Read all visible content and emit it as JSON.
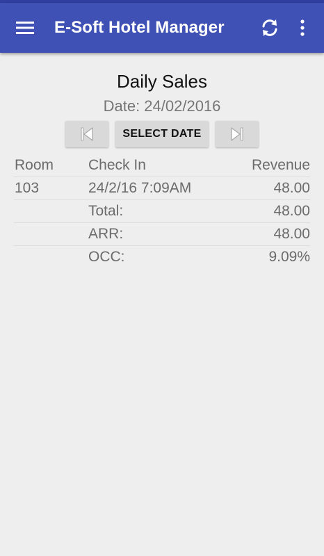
{
  "app_bar": {
    "title": "E-Soft Hotel Manager"
  },
  "report": {
    "title": "Daily Sales",
    "date": "Date: 24/02/2016",
    "select_date_label": "SELECT DATE"
  },
  "table": {
    "headers": {
      "room": "Room",
      "check_in": "Check In",
      "revenue": "Revenue"
    },
    "rows": [
      {
        "room": "103",
        "check_in": "24/2/16 7:09AM",
        "revenue": "48.00"
      }
    ],
    "summary": [
      {
        "label": "Total:",
        "value": "48.00"
      },
      {
        "label": "ARR:",
        "value": "48.00"
      },
      {
        "label": "OCC:",
        "value": "9.09%"
      }
    ]
  },
  "colors": {
    "app_bar": "#3f51b5",
    "status_bar": "#303f9f",
    "background": "#eeeeee",
    "button": "#d9d9d9"
  },
  "icons": {
    "menu": "hamburger-menu-icon",
    "refresh": "refresh-icon",
    "overflow": "more-vert-icon",
    "previous": "skip-previous-icon",
    "next": "skip-next-icon"
  }
}
